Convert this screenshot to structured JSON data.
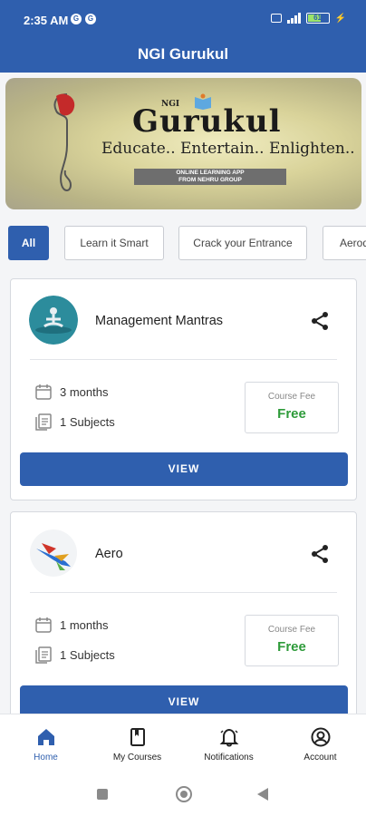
{
  "status_bar": {
    "time": "2:35 AM",
    "left_icons": [
      "G",
      "G"
    ],
    "battery": "61"
  },
  "app_bar": {
    "title": "NGI Gurukul"
  },
  "banner": {
    "small_text": "NGI",
    "logo_text": "Gurukul",
    "tagline": "Educate.. Entertain.. Enlighten..",
    "ribbon_line1": "ONLINE LEARNING APP",
    "ribbon_line2": "FROM NEHRU GROUP"
  },
  "filters": [
    {
      "label": "All",
      "active": true
    },
    {
      "label": "Learn it Smart",
      "active": false
    },
    {
      "label": "Crack your Entrance",
      "active": false
    },
    {
      "label": "Aerod",
      "active": false
    }
  ],
  "courses": [
    {
      "title": "Management Mantras",
      "duration": "3 months",
      "subjects": "1 Subjects",
      "fee_label": "Course Fee",
      "fee_value": "Free",
      "view_label": "VIEW",
      "icon": "meditation-icon"
    },
    {
      "title": "Aero",
      "duration": "1 months",
      "subjects": "1 Subjects",
      "fee_label": "Course Fee",
      "fee_value": "Free",
      "view_label": "VIEW",
      "icon": "airplane-icon"
    }
  ],
  "bottom_nav": [
    {
      "label": "Home",
      "icon": "home-icon",
      "active": true
    },
    {
      "label": "My Courses",
      "icon": "book-icon",
      "active": false
    },
    {
      "label": "Notifications",
      "icon": "bell-icon",
      "active": false
    },
    {
      "label": "Account",
      "icon": "account-icon",
      "active": false
    }
  ],
  "colors": {
    "primary": "#2f5fae",
    "fee_green": "#2e9b3a",
    "background": "#f4f5f7"
  }
}
